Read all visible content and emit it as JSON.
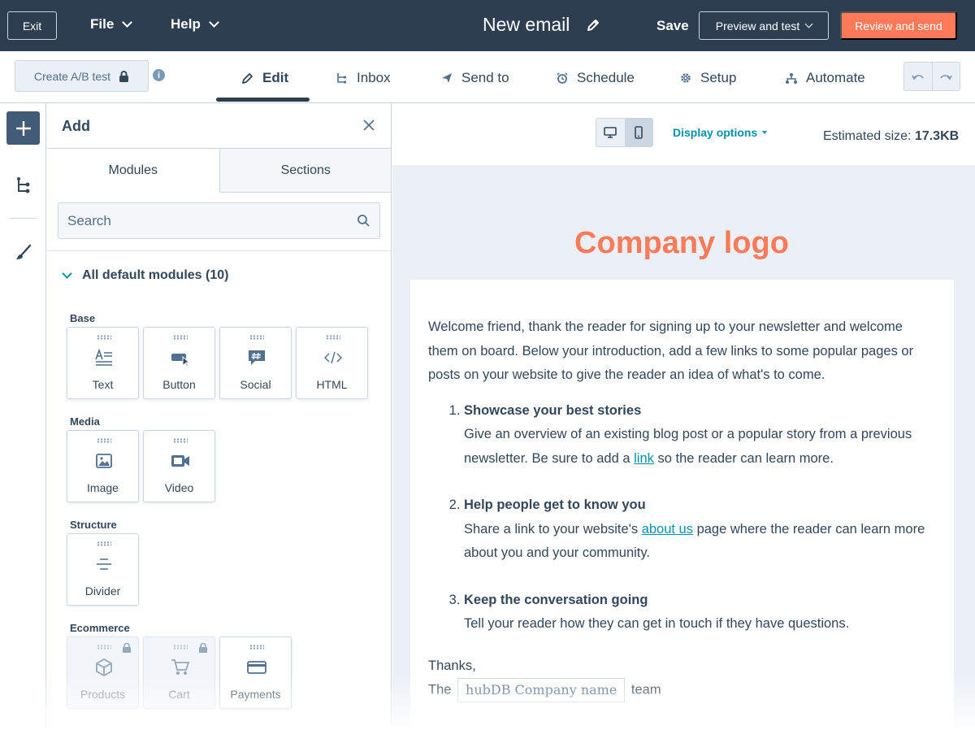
{
  "topbar": {
    "exit": "Exit",
    "file": "File",
    "help": "Help",
    "title": "New email",
    "save": "Save",
    "preview": "Preview and test",
    "review": "Review and send"
  },
  "tabbar": {
    "ab_test": "Create A/B test",
    "tabs": {
      "edit": "Edit",
      "inbox": "Inbox",
      "send_to": "Send to",
      "schedule": "Schedule",
      "setup": "Setup",
      "automate": "Automate"
    },
    "active_tab": "Edit"
  },
  "panel": {
    "title": "Add",
    "tab_modules": "Modules",
    "tab_sections": "Sections",
    "search_placeholder": "Search",
    "section_header": "All default modules (10)",
    "categories": {
      "base": "Base",
      "media": "Media",
      "structure": "Structure",
      "ecommerce": "Ecommerce"
    },
    "modules": {
      "text": "Text",
      "button": "Button",
      "social": "Social",
      "html": "HTML",
      "image": "Image",
      "video": "Video",
      "divider": "Divider",
      "products": "Products",
      "cart": "Cart",
      "payments": "Payments"
    }
  },
  "preview": {
    "display_options": "Display options",
    "estimated_label": "Estimated size:",
    "estimated_value": "17.3KB",
    "logo": "Company logo",
    "intro": "Welcome friend, thank the reader for signing up to your newsletter and welcome them on board. Below your introduction, add a few links to some popular pages or posts on your website to give the reader an idea of what's to come.",
    "item1_title": "Showcase your best stories",
    "item1_pre": "Give an overview of an existing blog post or a popular story from a previous newsletter. Be sure to add a ",
    "item1_link": "link",
    "item1_post": " so the reader can learn more.",
    "item2_title": "Help people get to know you",
    "item2_pre": "Share a link to your website's ",
    "item2_link": "about us",
    "item2_post": " page where the reader can learn more about you and your community.",
    "item3_title": "Keep the conversation going",
    "item3_body": "Tell your reader how they can get in touch if they have questions.",
    "thanks": "Thanks,",
    "sig_pre": "The",
    "sig_token": "hubDB  Company name",
    "sig_post": "team"
  },
  "colors": {
    "topbar": "#2d3e50",
    "accent_orange": "#ff7a59",
    "link_teal": "#0091ae",
    "canvas_bg": "#eaf0f6"
  }
}
